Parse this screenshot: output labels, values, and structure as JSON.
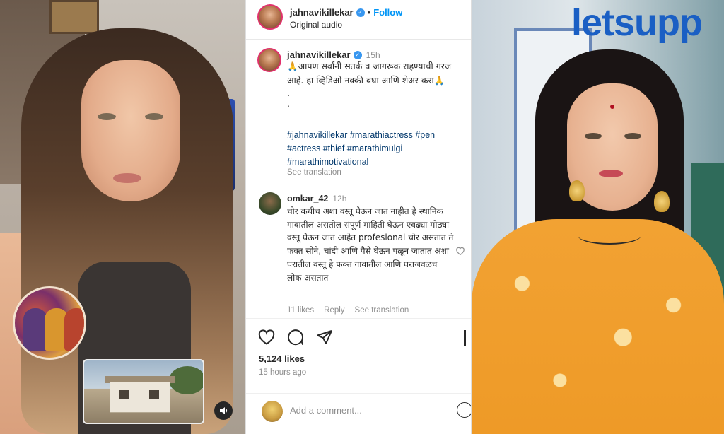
{
  "post": {
    "username": "jahnavikillekar",
    "follow_label": "Follow",
    "audio": "Original audio",
    "time": "15h",
    "caption_line1": "🙏आपण सर्वांनी सतर्क व जागरूक राहण्याची गरज आहे. हा व्हिडिओ नक्की बघा आणि शेअर करा🙏",
    "caption_dots": ".\n.",
    "hashtags": "#jahnavikillekar #marathiactress #pen #actress #thief #marathimulgi #marathimotivational",
    "see_translation": "See translation"
  },
  "comment": {
    "username": "omkar_42",
    "time": "12h",
    "text": "चोर कधीच अशा वस्तू घेऊन जात नाहीत हे स्थानिक गावातील असतील संपूर्ण माहिती घेऊन एवढ्या मोठ्या वस्तू घेऊन जात आहेत profesional चोर असतात ते फक्त सोने, चांदी आणि पैसे घेऊन पळून जातात अशा घरातील वस्तू हे फक्त गावातील आणि घराजवळच लोक असतात",
    "likes": "11 likes",
    "reply": "Reply",
    "see_translation": "See translation"
  },
  "footer": {
    "likes": "5,124 likes",
    "ago": "15 hours ago",
    "add_comment_placeholder": "Add a comment..."
  },
  "icons": {
    "like": "heart-icon",
    "comment": "comment-icon",
    "share": "share-icon",
    "save": "bookmark-icon",
    "sound": "speaker-icon",
    "emoji": "emoji-icon"
  },
  "brand": {
    "logo": "letsupp",
    "color": "#1a5fc4"
  },
  "colors": {
    "follow": "#0095f6",
    "hashtag": "#00376b",
    "muted": "#8e8e8e",
    "text": "#262626",
    "verified": "#3897f0"
  }
}
